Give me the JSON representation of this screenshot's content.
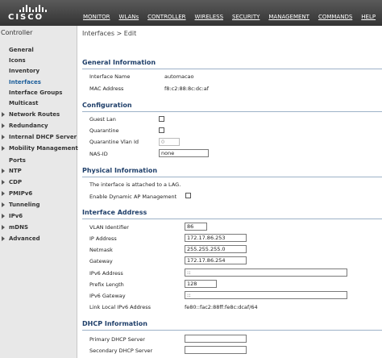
{
  "header": {
    "brand": "CISCO",
    "nav": [
      {
        "label": "MONITOR"
      },
      {
        "label": "WLANs"
      },
      {
        "label": "CONTROLLER"
      },
      {
        "label": "WIRELESS"
      },
      {
        "label": "SECURITY"
      },
      {
        "label": "MANAGEMENT"
      },
      {
        "label": "COMMANDS"
      },
      {
        "label": "HELP"
      }
    ]
  },
  "sidebar": {
    "title": "Controller",
    "items": [
      {
        "label": "General"
      },
      {
        "label": "Icons"
      },
      {
        "label": "Inventory"
      },
      {
        "label": "Interfaces"
      },
      {
        "label": "Interface Groups"
      },
      {
        "label": "Multicast"
      },
      {
        "label": "Network Routes"
      },
      {
        "label": "Redundancy"
      },
      {
        "label": "Internal DHCP Server"
      },
      {
        "label": "Mobility Management"
      },
      {
        "label": "Ports"
      },
      {
        "label": "NTP"
      },
      {
        "label": "CDP"
      },
      {
        "label": "PMIPv6"
      },
      {
        "label": "Tunneling"
      },
      {
        "label": "IPv6"
      },
      {
        "label": "mDNS"
      },
      {
        "label": "Advanced"
      }
    ]
  },
  "main": {
    "breadcrumb": "Interfaces > Edit",
    "general": {
      "heading": "General Information",
      "interface_name_label": "Interface Name",
      "interface_name_value": "automacao",
      "mac_label": "MAC Address",
      "mac_value": "f8:c2:88:8c:dc:af"
    },
    "configuration": {
      "heading": "Configuration",
      "guest_lan_label": "Guest Lan",
      "quarantine_label": "Quarantine",
      "quarantine_vlan_label": "Quarantine Vlan Id",
      "quarantine_vlan_value": "0",
      "nas_id_label": "NAS-ID",
      "nas_id_value": "none"
    },
    "physical": {
      "heading": "Physical Information",
      "lag_note": "The interface is attached to a LAG.",
      "dyn_ap_label": "Enable Dynamic AP Management"
    },
    "address": {
      "heading": "Interface Address",
      "vlan_label": "VLAN Identifier",
      "vlan_value": "86",
      "ip_label": "IP Address",
      "ip_value": "172.17.86.253",
      "netmask_label": "Netmask",
      "netmask_value": "255.255.255.0",
      "gateway_label": "Gateway",
      "gateway_value": "172.17.86.254",
      "ipv6_label": "IPv6 Address",
      "ipv6_value": "::",
      "prefix_label": "Prefix Length",
      "prefix_value": "128",
      "ipv6_gw_label": "IPv6 Gateway",
      "ipv6_gw_value": "::",
      "link_local_label": "Link Local IPv6 Address",
      "link_local_value": "fe80::fac2:88ff:fe8c:dcaf/64"
    },
    "dhcp": {
      "heading": "DHCP Information",
      "primary_label": "Primary DHCP Server",
      "primary_value": "",
      "secondary_label": "Secondary DHCP Server",
      "secondary_value": ""
    }
  }
}
